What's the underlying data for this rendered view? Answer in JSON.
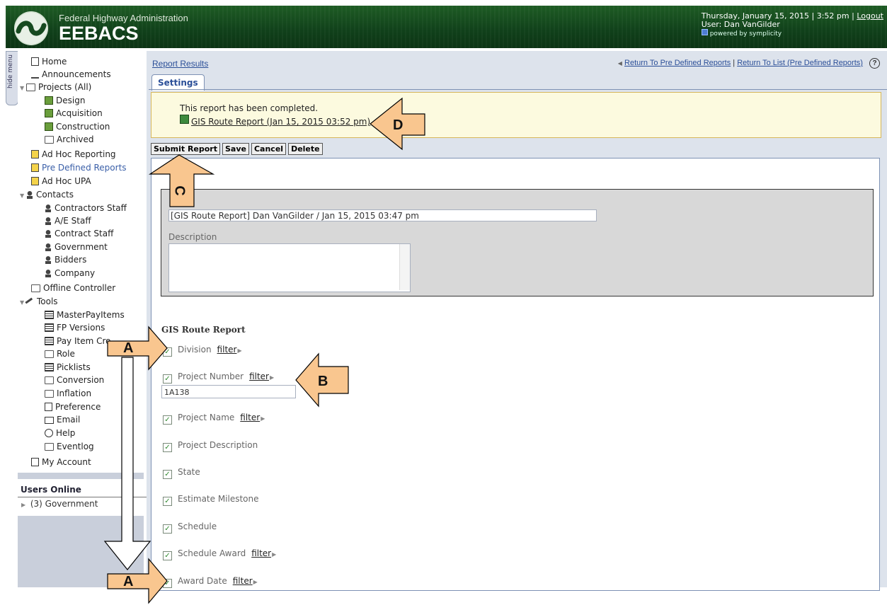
{
  "header": {
    "agency": "Federal Highway Administration",
    "brand": "EEBACS",
    "datetime": "Thursday, January 15, 2015 | 3:52 pm |",
    "logout": "Logout",
    "user": "User: Dan VanGilder",
    "powered_by": "powered by symplicity"
  },
  "hide_menu": "hide menu",
  "sidebar": {
    "items": [
      {
        "label": "Home",
        "icon": "home-icon"
      },
      {
        "label": "Announcements",
        "icon": "megaphone-icon"
      },
      {
        "label": "Projects (All)",
        "icon": "folder-icon"
      },
      {
        "label": "Design",
        "icon": "plus-box-icon"
      },
      {
        "label": "Acquisition",
        "icon": "plus-box-icon"
      },
      {
        "label": "Construction",
        "icon": "plus-box-icon"
      },
      {
        "label": "Archived",
        "icon": "folder-icon"
      },
      {
        "label": "Ad Hoc Reporting",
        "icon": "report-icon"
      },
      {
        "label": "Pre Defined Reports",
        "icon": "report-icon"
      },
      {
        "label": "Ad Hoc UPA",
        "icon": "report-icon"
      },
      {
        "label": "Contacts",
        "icon": "people-icon"
      },
      {
        "label": "Contractors Staff",
        "icon": "person-icon"
      },
      {
        "label": "A/E Staff",
        "icon": "person-icon"
      },
      {
        "label": "Contract Staff",
        "icon": "person-icon"
      },
      {
        "label": "Government",
        "icon": "person-icon"
      },
      {
        "label": "Bidders",
        "icon": "person-icon"
      },
      {
        "label": "Company",
        "icon": "person-icon"
      },
      {
        "label": "Offline Controller",
        "icon": "folder-icon"
      },
      {
        "label": "Tools",
        "icon": "tools-icon"
      },
      {
        "label": "MasterPayItems",
        "icon": "sheet-icon"
      },
      {
        "label": "FP Versions",
        "icon": "sheet-icon"
      },
      {
        "label": "Pay Item Cro",
        "icon": "sheet-icon"
      },
      {
        "label": "Role",
        "icon": "folder-icon"
      },
      {
        "label": "Picklists",
        "icon": "sheet-icon"
      },
      {
        "label": "Conversion",
        "icon": "folder-icon"
      },
      {
        "label": "Inflation",
        "icon": "folder-icon"
      },
      {
        "label": "Preference",
        "icon": "form-icon"
      },
      {
        "label": "Email",
        "icon": "email-icon"
      },
      {
        "label": "Help",
        "icon": "help-icon"
      },
      {
        "label": "Eventlog",
        "icon": "folder-icon"
      },
      {
        "label": "My Account",
        "icon": "account-icon"
      }
    ],
    "users_online_title": "Users Online",
    "users_online_item": "(3) Government"
  },
  "content": {
    "breadcrumb": "Report Results",
    "link_return_predefined": "Return To Pre Defined Reports",
    "separator": "|",
    "link_return_list": "Return To List (Pre Defined Reports)",
    "tab_settings": "Settings",
    "notice_message": "This report has been completed.",
    "notice_link": "GIS Route Report (Jan 15, 2015 03:52 pm)",
    "buttons": {
      "submit": "Submit Report",
      "save": "Save",
      "cancel": "Cancel",
      "delete": "Delete"
    },
    "report_name_value": "[GIS Route Report] Dan VanGilder / Jan 15, 2015 03:47 pm",
    "description_label": "Description",
    "section_title": "GIS Route Report",
    "filter_label": "filter",
    "project_number_value": "1A138",
    "fields": {
      "division": "Division",
      "project_number": "Project Number",
      "project_name": "Project Name",
      "project_description": "Project Description",
      "state": "State",
      "estimate_milestone": "Estimate Milestone",
      "schedule": "Schedule",
      "schedule_award": "Schedule Award",
      "award_date": "Award Date"
    }
  },
  "annotations": {
    "a_top": "A",
    "a_bottom": "A",
    "b": "B",
    "c": "C",
    "d": "D",
    "fill_color": "#f9c68f"
  }
}
